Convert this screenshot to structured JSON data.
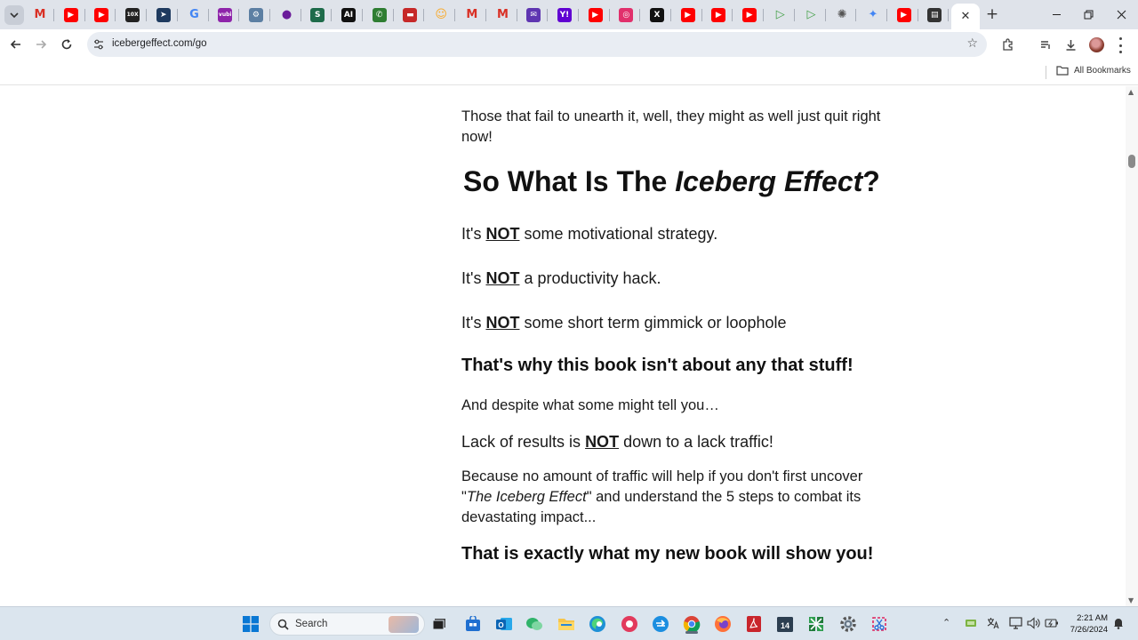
{
  "browser": {
    "address_url": "icebergeffect.com/go",
    "all_bookmarks_label": "All Bookmarks",
    "pinned_tabs": [
      {
        "icon": "gmail-icon",
        "glyph": "M",
        "color": "#d93025"
      },
      {
        "icon": "youtube-icon",
        "glyph": "▶",
        "color": "#ff0000"
      },
      {
        "icon": "youtube-icon",
        "glyph": "▶",
        "color": "#ff0000"
      },
      {
        "icon": "10x-icon",
        "glyph": "10X",
        "color": "#222222"
      },
      {
        "icon": "compass-icon",
        "glyph": "➤",
        "color": "#1e3a5f"
      },
      {
        "icon": "google-icon",
        "glyph": "G",
        "color": "#4285f4"
      },
      {
        "icon": "vubi-icon",
        "glyph": "vubi",
        "color": "#8e24aa"
      },
      {
        "icon": "robot-icon",
        "glyph": "⚙",
        "color": "#5c7fa3"
      },
      {
        "icon": "purple-circle-icon",
        "glyph": "●",
        "color": "#6a1b9a"
      },
      {
        "icon": "sheets-icon",
        "glyph": "S",
        "color": "#1e6b4a"
      },
      {
        "icon": "ai-icon",
        "glyph": "AI",
        "color": "#111111"
      },
      {
        "icon": "phone-icon",
        "glyph": "✆",
        "color": "#2e7d32"
      },
      {
        "icon": "red-box-icon",
        "glyph": "▬",
        "color": "#c62828"
      },
      {
        "icon": "emoji-icon",
        "glyph": "☺",
        "color": "#f9a825"
      },
      {
        "icon": "gmail-icon",
        "glyph": "M",
        "color": "#d93025"
      },
      {
        "icon": "gmail-icon",
        "glyph": "M",
        "color": "#d93025"
      },
      {
        "icon": "mail-icon",
        "glyph": "✉",
        "color": "#5e35b1"
      },
      {
        "icon": "yahoo-icon",
        "glyph": "Y!",
        "color": "#6001d2"
      },
      {
        "icon": "youtube-icon",
        "glyph": "▶",
        "color": "#ff0000"
      },
      {
        "icon": "instagram-icon",
        "glyph": "◎",
        "color": "#e1306c"
      },
      {
        "icon": "x-icon",
        "glyph": "X",
        "color": "#111111"
      },
      {
        "icon": "youtube-icon",
        "glyph": "▶",
        "color": "#ff0000"
      },
      {
        "icon": "youtube-icon",
        "glyph": "▶",
        "color": "#ff0000"
      },
      {
        "icon": "youtube-icon",
        "glyph": "▶",
        "color": "#ff0000"
      },
      {
        "icon": "play-green-icon",
        "glyph": "▷",
        "color": "#43a047"
      },
      {
        "icon": "play-green-icon",
        "glyph": "▷",
        "color": "#43a047"
      },
      {
        "icon": "openai-icon",
        "glyph": "✺",
        "color": "#555555"
      },
      {
        "icon": "gemini-icon",
        "glyph": "✦",
        "color": "#4285f4"
      },
      {
        "icon": "youtube-icon",
        "glyph": "▶",
        "color": "#ff0000"
      },
      {
        "icon": "newspaper-icon",
        "glyph": "▤",
        "color": "#333333"
      }
    ]
  },
  "page": {
    "intro": "Those that fail to unearth it, well, they might as well just quit right now!",
    "heading_prefix": "So What Is The ",
    "heading_emphasis": "Iceberg Effect",
    "heading_suffix": "?",
    "not_lines": [
      {
        "pre": "It's ",
        "not": "NOT",
        "post": " some motivational strategy."
      },
      {
        "pre": "It's ",
        "not": "NOT",
        "post": " a productivity hack."
      },
      {
        "pre": "It's ",
        "not": "NOT",
        "post": " some short term gimmick or loophole"
      }
    ],
    "subheading_1": "That's why this book isn't about any that stuff!",
    "despite": "And despite what some might tell you…",
    "lack_pre": "Lack of results is ",
    "lack_not": "NOT",
    "lack_post": " down to a lack traffic!",
    "because_1": "Because no amount of traffic will help if you don't first uncover",
    "because_quote_open": "\"",
    "because_emphasis": "The Iceberg Effect",
    "because_2": "\" and understand the 5 steps to combat its",
    "because_3": "devastating impact...",
    "subheading_2": "That is exactly what my new book will show you!"
  },
  "taskbar": {
    "search_label": "Search",
    "time": "2:21 AM",
    "date": "7/26/2024"
  }
}
